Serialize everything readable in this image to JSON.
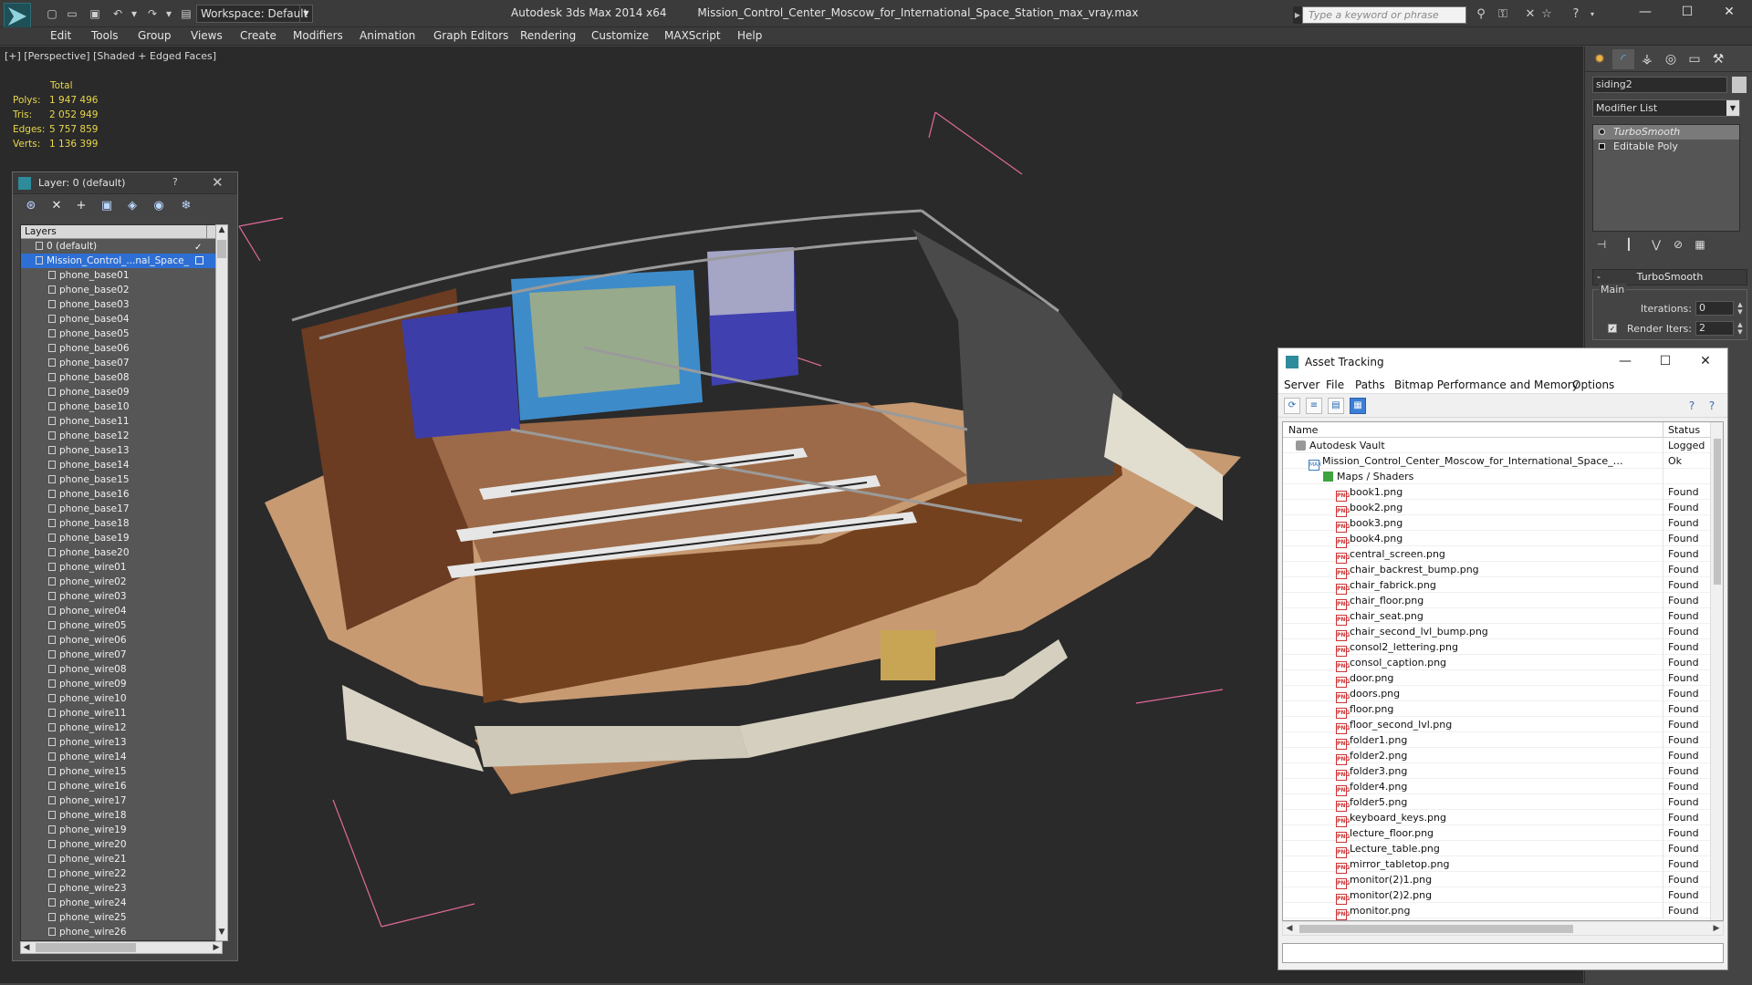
{
  "titlebar": {
    "workspace": "Workspace: Default",
    "app_name": "Autodesk 3ds Max  2014 x64",
    "file_name": "Mission_Control_Center_Moscow_for_International_Space_Station_max_vray.max",
    "search_placeholder": "Type a keyword or phrase"
  },
  "menu": [
    "Edit",
    "Tools",
    "Group",
    "Views",
    "Create",
    "Modifiers",
    "Animation",
    "Graph Editors",
    "Rendering",
    "Customize",
    "MAXScript",
    "Help"
  ],
  "viewport": {
    "label": "[+] [Perspective] [Shaded + Edged Faces]",
    "stats_total": "Total",
    "stats": [
      {
        "k": "Polys:",
        "v": "1 947 496"
      },
      {
        "k": "Tris:",
        "v": "2 052 949"
      },
      {
        "k": "Edges:",
        "v": "5 757 859"
      },
      {
        "k": "Verts:",
        "v": "1 136 399"
      }
    ]
  },
  "layer_panel": {
    "title": "Layer: 0 (default)",
    "help": "?",
    "header": "Layers",
    "rows": [
      "0 (default)",
      "Mission_Control_...nal_Space_",
      "phone_base01",
      "phone_base02",
      "phone_base03",
      "phone_base04",
      "phone_base05",
      "phone_base06",
      "phone_base07",
      "phone_base08",
      "phone_base09",
      "phone_base10",
      "phone_base11",
      "phone_base12",
      "phone_base13",
      "phone_base14",
      "phone_base15",
      "phone_base16",
      "phone_base17",
      "phone_base18",
      "phone_base19",
      "phone_base20",
      "phone_wire01",
      "phone_wire02",
      "phone_wire03",
      "phone_wire04",
      "phone_wire05",
      "phone_wire06",
      "phone_wire07",
      "phone_wire08",
      "phone_wire09",
      "phone_wire10",
      "phone_wire11",
      "phone_wire12",
      "phone_wire13",
      "phone_wire14",
      "phone_wire15",
      "phone_wire16",
      "phone_wire17",
      "phone_wire18",
      "phone_wire19",
      "phone_wire20",
      "phone_wire21",
      "phone_wire22",
      "phone_wire23",
      "phone_wire24",
      "phone_wire25",
      "phone_wire26"
    ]
  },
  "command_panel": {
    "object_name": "siding2",
    "modifier_list": "Modifier List",
    "stack": [
      "TurboSmooth",
      "Editable Poly"
    ],
    "rollout": "TurboSmooth",
    "group": "Main",
    "iterations_label": "Iterations:",
    "iterations_value": "0",
    "render_iters_label": "Render Iters:",
    "render_iters_value": "2"
  },
  "asset_tracking": {
    "title": "Asset Tracking",
    "menu": [
      "Server",
      "File",
      "Paths",
      "Bitmap Performance and Memory",
      "Options"
    ],
    "col_name": "Name",
    "col_status": "Status",
    "rows": [
      {
        "name": "Autodesk Vault",
        "status": "Logged",
        "level": 0,
        "icon": "vault"
      },
      {
        "name": "Mission_Control_Center_Moscow_for_International_Space_Station_...",
        "status": "Ok",
        "level": 1,
        "icon": "max"
      },
      {
        "name": "Maps / Shaders",
        "status": "",
        "level": 2,
        "icon": "folder"
      },
      {
        "name": "book1.png",
        "status": "Found",
        "level": 3,
        "icon": "png"
      },
      {
        "name": "book2.png",
        "status": "Found",
        "level": 3,
        "icon": "png"
      },
      {
        "name": "book3.png",
        "status": "Found",
        "level": 3,
        "icon": "png"
      },
      {
        "name": "book4.png",
        "status": "Found",
        "level": 3,
        "icon": "png"
      },
      {
        "name": "central_screen.png",
        "status": "Found",
        "level": 3,
        "icon": "png"
      },
      {
        "name": "chair_backrest_bump.png",
        "status": "Found",
        "level": 3,
        "icon": "png"
      },
      {
        "name": "chair_fabrick.png",
        "status": "Found",
        "level": 3,
        "icon": "png"
      },
      {
        "name": "chair_floor.png",
        "status": "Found",
        "level": 3,
        "icon": "png"
      },
      {
        "name": "chair_seat.png",
        "status": "Found",
        "level": 3,
        "icon": "png"
      },
      {
        "name": "chair_second_lvl_bump.png",
        "status": "Found",
        "level": 3,
        "icon": "png"
      },
      {
        "name": "consol2_lettering.png",
        "status": "Found",
        "level": 3,
        "icon": "png"
      },
      {
        "name": "consol_caption.png",
        "status": "Found",
        "level": 3,
        "icon": "png"
      },
      {
        "name": "door.png",
        "status": "Found",
        "level": 3,
        "icon": "png"
      },
      {
        "name": "doors.png",
        "status": "Found",
        "level": 3,
        "icon": "png"
      },
      {
        "name": "floor.png",
        "status": "Found",
        "level": 3,
        "icon": "png"
      },
      {
        "name": "floor_second_lvl.png",
        "status": "Found",
        "level": 3,
        "icon": "png"
      },
      {
        "name": "folder1.png",
        "status": "Found",
        "level": 3,
        "icon": "png"
      },
      {
        "name": "folder2.png",
        "status": "Found",
        "level": 3,
        "icon": "png"
      },
      {
        "name": "folder3.png",
        "status": "Found",
        "level": 3,
        "icon": "png"
      },
      {
        "name": "folder4.png",
        "status": "Found",
        "level": 3,
        "icon": "png"
      },
      {
        "name": "folder5.png",
        "status": "Found",
        "level": 3,
        "icon": "png"
      },
      {
        "name": "keyboard_keys.png",
        "status": "Found",
        "level": 3,
        "icon": "png"
      },
      {
        "name": "lecture_floor.png",
        "status": "Found",
        "level": 3,
        "icon": "png"
      },
      {
        "name": "Lecture_table.png",
        "status": "Found",
        "level": 3,
        "icon": "png"
      },
      {
        "name": "mirror_tabletop.png",
        "status": "Found",
        "level": 3,
        "icon": "png"
      },
      {
        "name": "monitor(2)1.png",
        "status": "Found",
        "level": 3,
        "icon": "png"
      },
      {
        "name": "monitor(2)2.png",
        "status": "Found",
        "level": 3,
        "icon": "png"
      },
      {
        "name": "monitor.png",
        "status": "Found",
        "level": 3,
        "icon": "png"
      }
    ]
  }
}
